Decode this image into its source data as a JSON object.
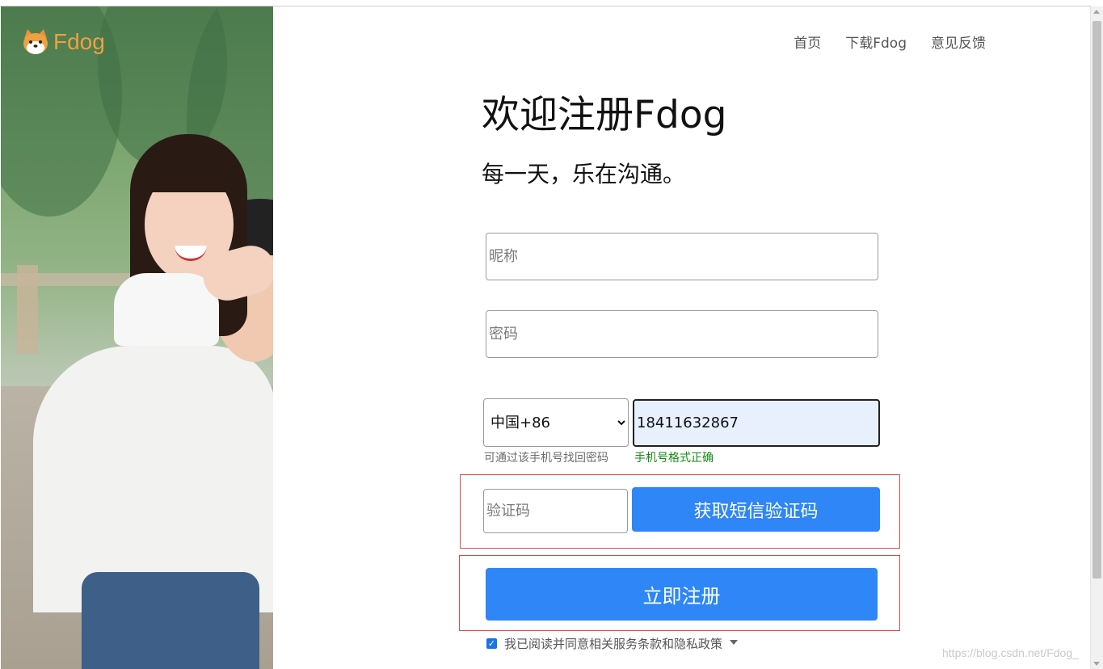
{
  "brand": {
    "name": "Fdog"
  },
  "nav": {
    "home": "首页",
    "download": "下载Fdog",
    "feedback": "意见反馈"
  },
  "hero": {
    "title": "欢迎注册Fdog",
    "subtitle": "每一天，乐在沟通。"
  },
  "form": {
    "nickname_placeholder": "昵称",
    "password_placeholder": "密码",
    "country_selected": "中国+86",
    "phone_value": "18411632867",
    "phone_hint": "可通过该手机号找回密码",
    "phone_valid": "手机号格式正确",
    "code_placeholder": "验证码",
    "get_code_label": "获取短信验证码",
    "register_label": "立即注册",
    "agree_text": "我已阅读并同意相关服务条款和隐私政策",
    "agree_checked": true
  },
  "watermark": "https://blog.csdn.net/Fdog_",
  "colors": {
    "primary": "#2e86f7",
    "valid": "#138a13",
    "highlight": "#e04848",
    "brand": "#f0a040"
  },
  "icons": {
    "logo": "shiba-dog-icon",
    "agree_caret": "caret-down-icon"
  }
}
